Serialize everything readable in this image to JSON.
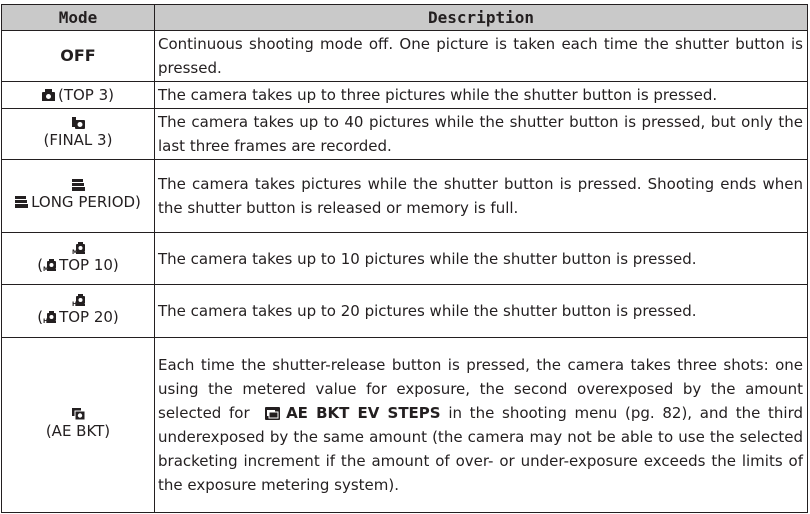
{
  "header": {
    "mode": "Mode",
    "description": "Description"
  },
  "rows": [
    {
      "mode": "OFF",
      "mode_sub": "",
      "icon": "",
      "description": "Continuous shooting mode off.  One picture is taken each time the shutter button is pressed."
    },
    {
      "mode": "",
      "mode_sub": "(TOP 3)",
      "icon": "top3-burst-icon",
      "description": "The camera takes up to three pictures while the shutter button is pressed."
    },
    {
      "mode": "",
      "mode_sub": "(FINAL 3)",
      "icon": "final3-burst-icon",
      "description": "The camera takes up to 40 pictures while the shutter button is pressed, but only the last three frames are recorded."
    },
    {
      "mode": "",
      "mode_sub": "LONG PERIOD)",
      "icon": "long-period-burst-icon",
      "description": "The camera takes pictures while the shutter button is pressed. Shooting ends when the shutter button is released or memory is full."
    },
    {
      "mode": "",
      "mode_sub": "TOP 10)",
      "icon": "top10-burst-icon",
      "description": "The camera takes up to 10 pictures while the shutter button is pressed."
    },
    {
      "mode": "",
      "mode_sub": "TOP 20)",
      "icon": "top20-burst-icon",
      "description": "The camera takes up to 20 pictures while the shutter button is pressed."
    },
    {
      "mode": "",
      "mode_sub": "(AE BKT)",
      "icon": "ae-bracketing-icon",
      "description_part1": "Each time the shutter-release button is pressed, the camera takes three shots: one using the metered value for exposure, the second overexposed by the amount selected for",
      "description_menu": "AE BKT EV STEPS",
      "description_part2": "in the shooting menu (pg. 82), and the third underexposed by the same amount (the camera may not be able to use the selected bracketing increment if the amount of over- or under-exposure exceeds the limits of the exposure metering system)."
    }
  ]
}
